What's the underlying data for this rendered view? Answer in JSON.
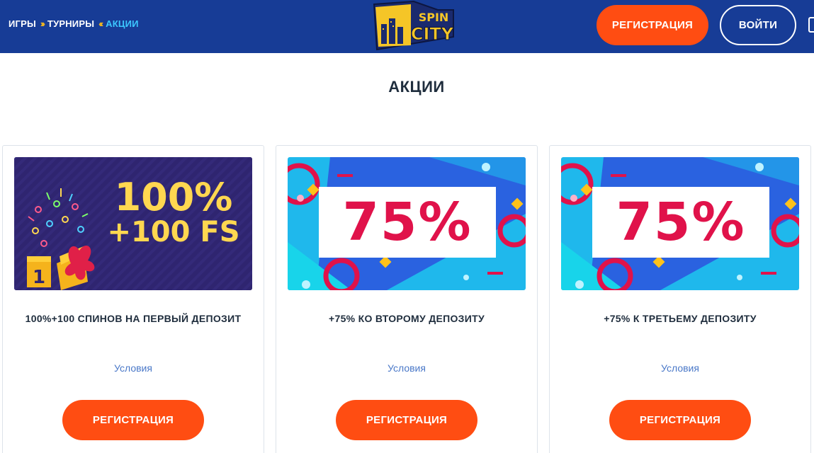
{
  "nav": {
    "items": [
      {
        "label": "ИГРЫ"
      },
      {
        "label": "ТУРНИРЫ"
      },
      {
        "label": "АКЦИИ"
      }
    ],
    "sep_forward": "›››",
    "sep_back": "‹‹‹"
  },
  "logo": {
    "line1": "SPIN",
    "line2": "CITY"
  },
  "header": {
    "register_label": "РЕГИСТРАЦИЯ",
    "login_label": "ВОЙТИ"
  },
  "page": {
    "title": "АКЦИИ"
  },
  "cards": [
    {
      "banner_line1": "100%",
      "banner_line2": "+100 FS",
      "offer": "100%+100 СПИНОВ НА ПЕРВЫЙ ДЕПОЗИТ",
      "terms": "Условия",
      "button": "РЕГИСТРАЦИЯ"
    },
    {
      "banner_text": "75%",
      "offer": "+75% КО ВТОРОМУ ДЕПОЗИТУ",
      "terms": "Условия",
      "button": "РЕГИСТРАЦИЯ"
    },
    {
      "banner_text": "75%",
      "offer": "+75% К ТРЕТЬЕМУ ДЕПОЗИТУ",
      "terms": "Условия",
      "button": "РЕГИСТРАЦИЯ"
    }
  ],
  "colors": {
    "header_bg": "#173c96",
    "accent_orange": "#ff4d12",
    "active_nav": "#3cc8ff",
    "percent_red": "#e0124a",
    "gold": "#ffd750"
  }
}
